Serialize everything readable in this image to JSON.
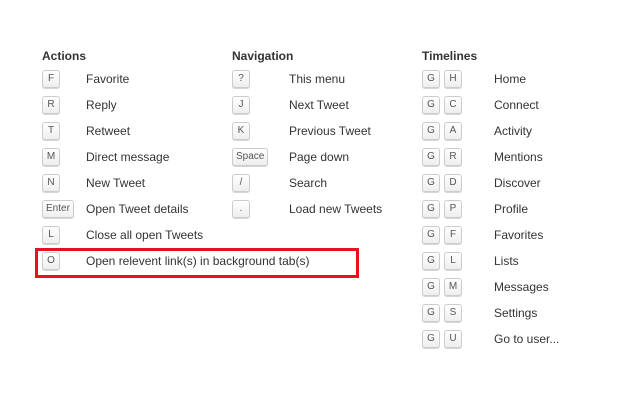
{
  "actions": {
    "title": "Actions",
    "items": [
      {
        "key": "F",
        "label": "Favorite"
      },
      {
        "key": "R",
        "label": "Reply"
      },
      {
        "key": "T",
        "label": "Retweet"
      },
      {
        "key": "M",
        "label": "Direct message"
      },
      {
        "key": "N",
        "label": "New Tweet"
      },
      {
        "key": "Enter",
        "label": "Open Tweet details"
      },
      {
        "key": "L",
        "label": "Close all open Tweets"
      },
      {
        "key": "O",
        "label": "Open relevent link(s) in background tab(s)"
      }
    ]
  },
  "navigation": {
    "title": "Navigation",
    "items": [
      {
        "key": "?",
        "label": "This menu"
      },
      {
        "key": "J",
        "label": "Next Tweet"
      },
      {
        "key": "K",
        "label": "Previous Tweet"
      },
      {
        "key": "Space",
        "label": "Page down"
      },
      {
        "key": "/",
        "label": "Search"
      },
      {
        "key": ".",
        "label": "Load new Tweets"
      }
    ]
  },
  "timelines": {
    "title": "Timelines",
    "items": [
      {
        "key1": "G",
        "key2": "H",
        "label": "Home"
      },
      {
        "key1": "G",
        "key2": "C",
        "label": "Connect"
      },
      {
        "key1": "G",
        "key2": "A",
        "label": "Activity"
      },
      {
        "key1": "G",
        "key2": "R",
        "label": "Mentions"
      },
      {
        "key1": "G",
        "key2": "D",
        "label": "Discover"
      },
      {
        "key1": "G",
        "key2": "P",
        "label": "Profile"
      },
      {
        "key1": "G",
        "key2": "F",
        "label": "Favorites"
      },
      {
        "key1": "G",
        "key2": "L",
        "label": "Lists"
      },
      {
        "key1": "G",
        "key2": "M",
        "label": "Messages"
      },
      {
        "key1": "G",
        "key2": "S",
        "label": "Settings"
      },
      {
        "key1": "G",
        "key2": "U",
        "label": "Go to user..."
      }
    ]
  },
  "colors": {
    "highlight": "#e8101a",
    "text": "#333333",
    "key_border": "#cccccc"
  }
}
